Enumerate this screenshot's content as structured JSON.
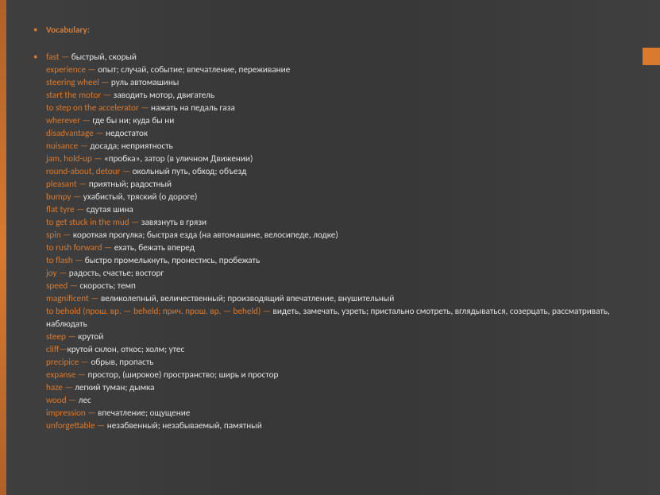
{
  "slide": {
    "heading": "Vocabulary:",
    "entries": [
      {
        "term": "fast",
        "def": "быстрый, скорый"
      },
      {
        "term": "experience",
        "def": "опыт; случай, событие; впечатление, переживание"
      },
      {
        "term": "steering wheel",
        "def": "руль автомашины"
      },
      {
        "term": "start the motor",
        "def": "заводить мотор, двигатель"
      },
      {
        "term": "to step on the accelerator",
        "def": "нажать на педаль газа"
      },
      {
        "term": "wherever",
        "def": "где бы ни; куда бы ни"
      },
      {
        "term": "disadvantage",
        "def": "недостаток"
      },
      {
        "term": "nuisance",
        "def": "досада; неприятность"
      },
      {
        "term": "jam, hold-up",
        "def": "«пробка», затор (в уличном Движении)"
      },
      {
        "term": "round-about, detour",
        "def": "окольный путь, обход; объезд"
      },
      {
        "term": "pleasant",
        "def": "приятный; радостный"
      },
      {
        "term": "bumpy",
        "def": "ухабистый, тряский (о дороге)"
      },
      {
        "term": "flat tyre",
        "def": "сдутая шина"
      },
      {
        "term": "to get stuck in the mud",
        "def": "завязнуть в грязи"
      },
      {
        "term": "spin",
        "def": "короткая прогулка; быстрая езда (на автомашине, велосипеде, лодке)"
      },
      {
        "term": "to rush forward",
        "def": "ехать, бежать вперед"
      },
      {
        "term": "to flash",
        "def": "быстро промелькнуть, пронестись, пробежать"
      },
      {
        "term": "joy",
        "def": "радость, счастье; восторг"
      },
      {
        "term": "speed",
        "def": "скорость; темп"
      },
      {
        "term": "magnificent",
        "def": "великолепный, величественный; производящий впечатление, внушительный"
      },
      {
        "term": "to behold (прош. вр. — beheld; прич. прош. вр. — beheld)",
        "def": "видеть, замечать, узреть; пристально смотреть, вглядываться, созерцать, рассматривать, наблюдать"
      },
      {
        "term": "steep",
        "def": "крутой"
      },
      {
        "term": "cliff",
        "def": "крутой склон, откос; холм; утес",
        "nospace": true
      },
      {
        "term": "precipice",
        "def": "обрыв, пропасть"
      },
      {
        "term": "expanse",
        "def": "простор, (широкое) пространство; ширь и простор"
      },
      {
        "term": "haze",
        "def": "легкий туман; дымка"
      },
      {
        "term": "wood",
        "def": "лес"
      },
      {
        "term": "impression",
        "def": "впечатление; ощущение"
      },
      {
        "term": "unforgettable",
        "def": "незабвенный; незабываемый, памятный"
      }
    ]
  }
}
